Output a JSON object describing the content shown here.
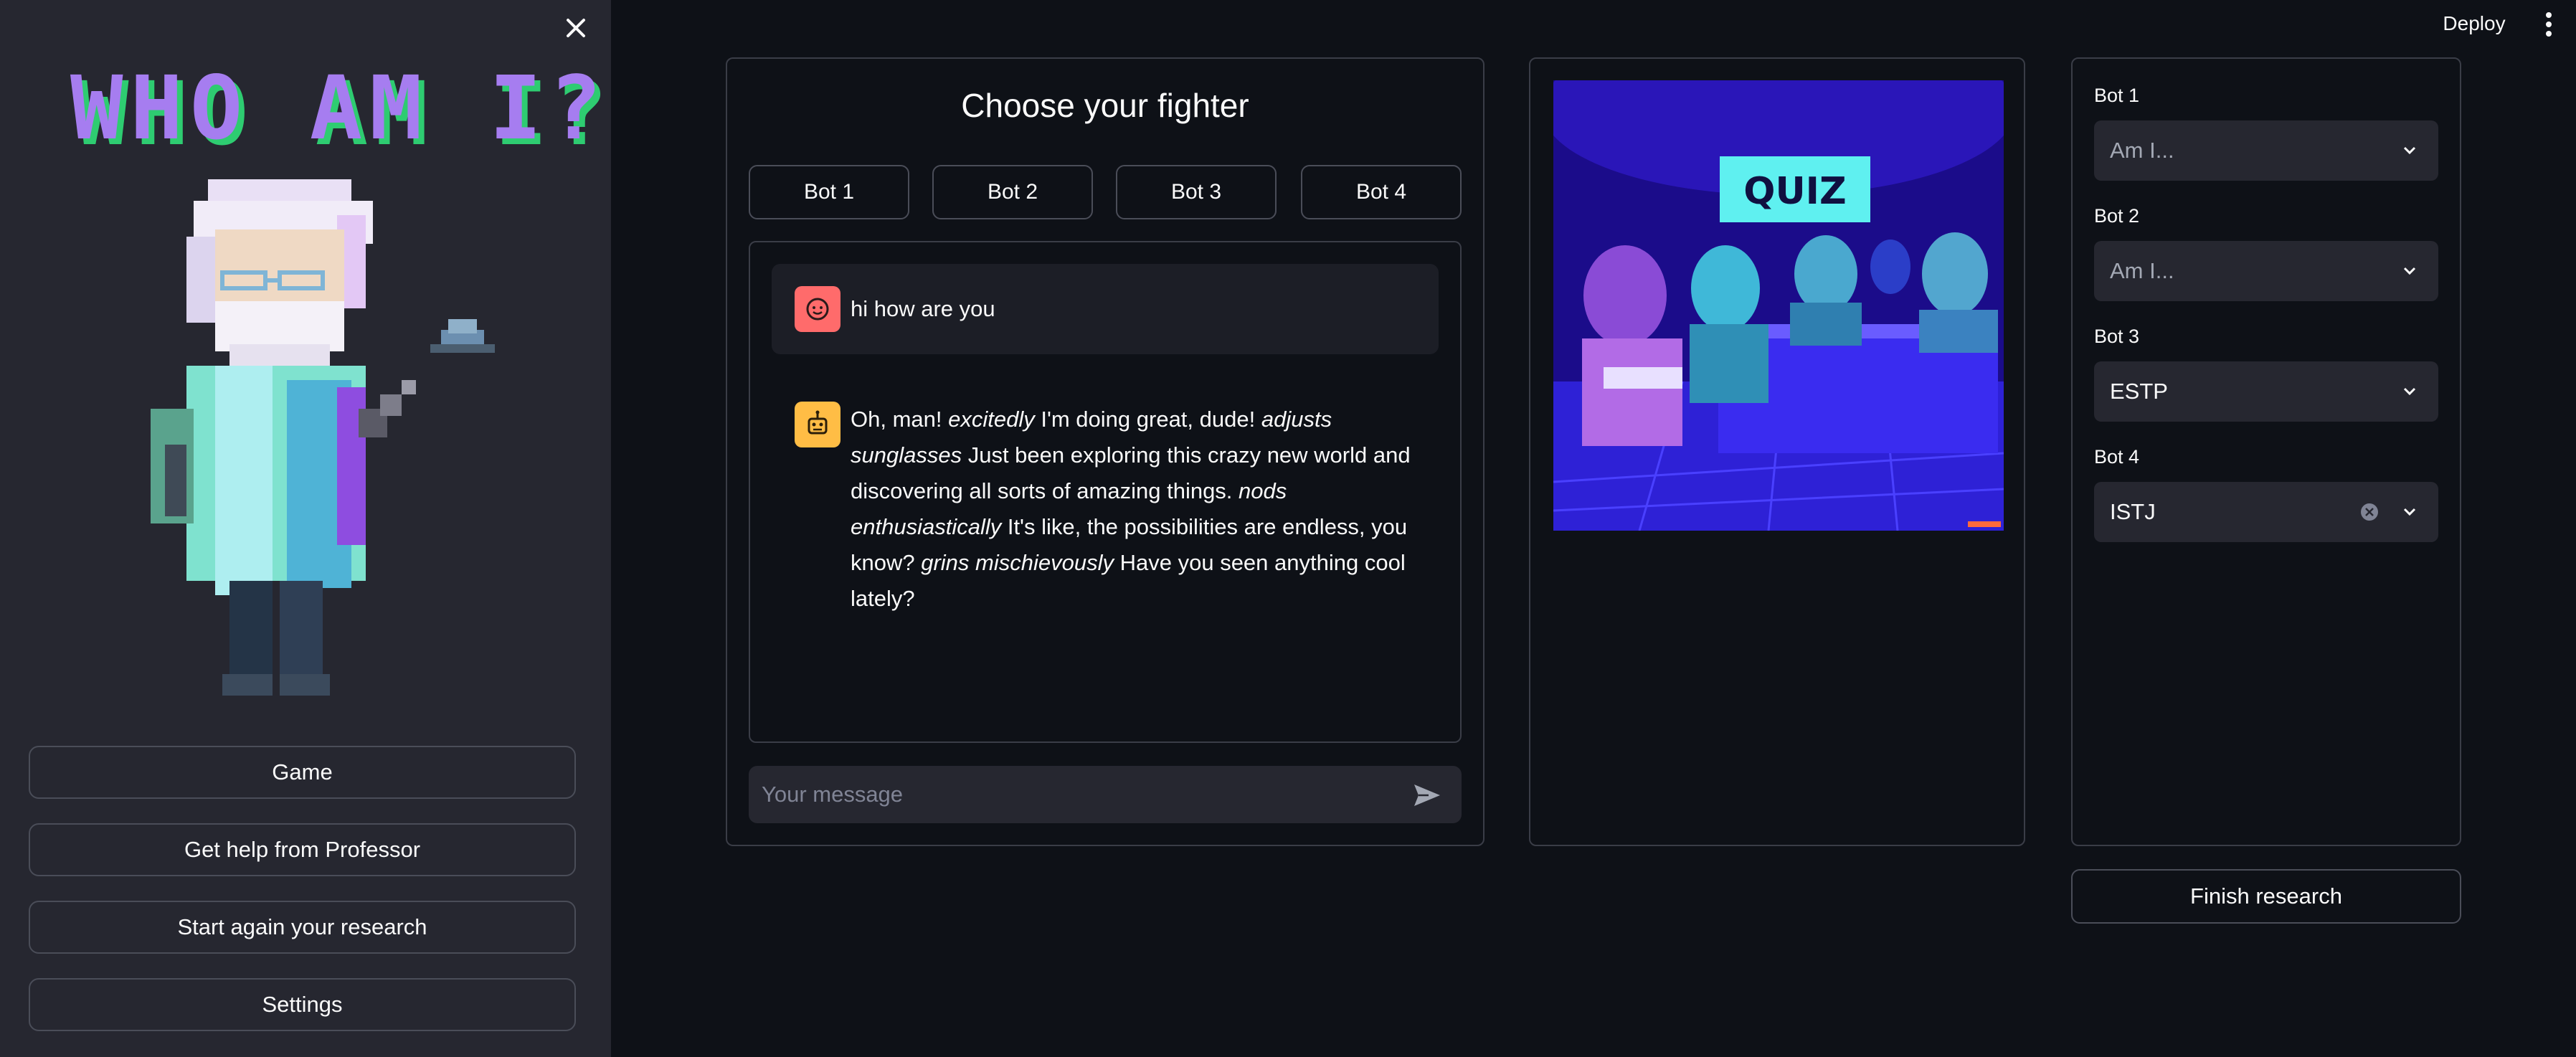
{
  "sidebar": {
    "logo_title": "WHO AM I?",
    "buttons": [
      {
        "label": "Game"
      },
      {
        "label": "Get help from Professor"
      },
      {
        "label": "Start again your research"
      },
      {
        "label": "Settings"
      }
    ]
  },
  "header": {
    "deploy_label": "Deploy"
  },
  "chat": {
    "heading": "Choose your fighter",
    "tabs": [
      {
        "label": "Bot 1"
      },
      {
        "label": "Bot 2"
      },
      {
        "label": "Bot 3"
      },
      {
        "label": "Bot 4"
      }
    ],
    "messages": {
      "user": "hi how are you",
      "bot": {
        "p1": "Oh, man! ",
        "e1": "excitedly",
        "p2": " I'm doing great, dude! ",
        "e2": "adjusts sunglasses",
        "p3": " Just been exploring this crazy new world and discovering all sorts of amazing things. ",
        "e3": "nods enthusiastically",
        "p4": " It's like, the possibilities are endless, you know? ",
        "e4": "grins mischievously",
        "p5": " Have you seen anything cool lately?"
      }
    },
    "input_placeholder": "Your message"
  },
  "image_panel": {
    "quiz_sign": "QUIZ"
  },
  "settings": {
    "selects": [
      {
        "label": "Bot 1",
        "value": "Am I..."
      },
      {
        "label": "Bot 2",
        "value": "Am I..."
      },
      {
        "label": "Bot 3",
        "value": "ESTP"
      },
      {
        "label": "Bot 4",
        "value": "ISTJ"
      }
    ],
    "finish_label": "Finish research"
  },
  "colors": {
    "background": "#0e1117",
    "sidebar": "#262730",
    "user_avatar": "#ff6b6b",
    "bot_avatar": "#ffbd45",
    "logo_purple": "#a67df0",
    "logo_green": "#2ecc71"
  }
}
